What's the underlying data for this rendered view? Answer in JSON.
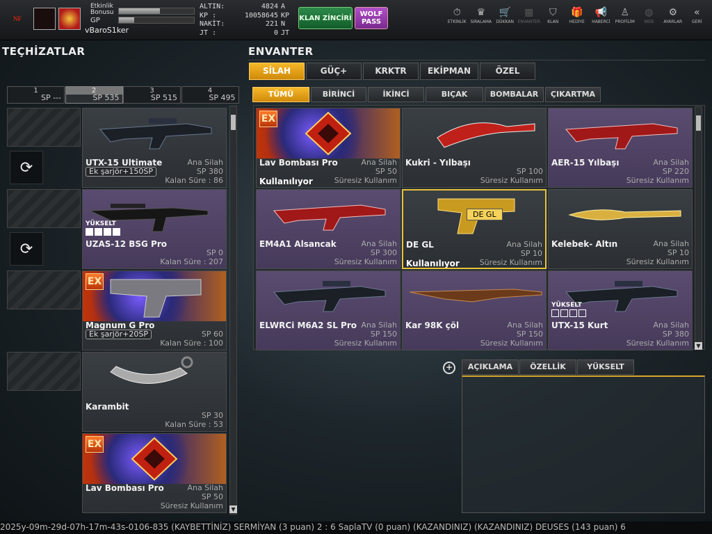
{
  "profile": {
    "bonus_label": "Etkinlik Bonusu",
    "gp_label": "GP",
    "username": "vBaroS1ker",
    "bonus_fill": 0.55,
    "gp_fill": 0.2
  },
  "currency": [
    {
      "label": "ALTIN:",
      "value": "4824",
      "unit": "A"
    },
    {
      "label": "KP   :",
      "value": "10058645",
      "unit": "KP"
    },
    {
      "label": "NAKİT:",
      "value": "221",
      "unit": "N"
    },
    {
      "label": "JT   :",
      "value": "0",
      "unit": "JT"
    }
  ],
  "buttons": {
    "clan": "KLAN ZİNCİRİ",
    "wolf": "WOLF PASS"
  },
  "nav": [
    {
      "label": "ETKİNLİK",
      "icon": "⏱",
      "dim": false
    },
    {
      "label": "SIRALAMA",
      "icon": "♛",
      "dim": false
    },
    {
      "label": "DÜKKAN",
      "icon": "🛒",
      "dim": false
    },
    {
      "label": "ENVANTER",
      "icon": "▦",
      "dim": true
    },
    {
      "label": "KLAN",
      "icon": "⛉",
      "dim": false
    },
    {
      "label": "HEDİYE",
      "icon": "🎁",
      "dim": false
    },
    {
      "label": "HABERCİ",
      "icon": "📢",
      "dim": false
    },
    {
      "label": "PROFİLİM",
      "icon": "♙",
      "dim": false
    },
    {
      "label": "WEB",
      "icon": "◍",
      "dim": true
    },
    {
      "label": "AYARLAR",
      "icon": "⚙",
      "dim": false
    },
    {
      "label": "GERİ",
      "icon": "«",
      "dim": false
    }
  ],
  "titles": {
    "equip": "TEÇHİZATLAR",
    "inventory": "ENVANTER"
  },
  "sp_tabs": [
    {
      "num": "1",
      "sp": "SP ---"
    },
    {
      "num": "2",
      "sp": "SP 535"
    },
    {
      "num": "3",
      "sp": "SP 515"
    },
    {
      "num": "4",
      "sp": "SP 495"
    }
  ],
  "equipment": [
    {
      "name": "UTX-15 Ultimate",
      "cat": "Ana Silah",
      "sp": "SP 380",
      "dur": "Kalan Süre : 86",
      "opt": "Ek şarjör+150SP"
    },
    {
      "name": "UZAS-12 BSG Pro",
      "sp": "SP 0",
      "dur": "Kalan Süre : 207",
      "yuksel": "YÜKSELT"
    },
    {
      "name": "Magnum G Pro",
      "sp": "SP 60",
      "dur": "Kalan Süre : 100",
      "opt": "Ek şarjör+20SP",
      "ex": "EX"
    },
    {
      "name": "Karambit",
      "sp": "SP 30",
      "dur": "Kalan Süre : 53"
    },
    {
      "name": "Lav Bombası Pro",
      "cat": "Ana Silah",
      "sp": "SP 50",
      "dur": "Süresiz Kullanım",
      "ex": "EX"
    }
  ],
  "main_tabs": [
    "SİLAH",
    "GÜÇ+",
    "KRKTR",
    "EKİPMAN",
    "ÖZEL"
  ],
  "sub_tabs": [
    "TÜMÜ",
    "BİRİNCİ",
    "İKİNCİ",
    "BIÇAK",
    "BOMBALAR",
    "ÇIKARTMA"
  ],
  "inventory": [
    {
      "name": "Lav Bombası Pro",
      "cat": "Ana Silah",
      "sp": "SP 50",
      "dur": "Süresiz Kullanım",
      "using": "Kullanılıyor",
      "ex": "EX"
    },
    {
      "name": "Kukri - Yılbaşı",
      "sp": "SP 100",
      "dur": "Süresiz Kullanım"
    },
    {
      "name": "AER-15 Yılbaşı",
      "cat": "Ana Silah",
      "sp": "SP 220",
      "dur": "Süresiz Kullanım"
    },
    {
      "name": "EM4A1 Alsancak",
      "cat": "Ana Silah",
      "sp": "SP 300",
      "dur": "Süresiz Kullanım"
    },
    {
      "name": "DE GL",
      "cat": "Ana Silah",
      "sp": "SP 10",
      "dur": "Süresiz Kullanım",
      "using": "Kullanılıyor"
    },
    {
      "name": "Kelebek- Altın",
      "cat": "Ana Silah",
      "sp": "SP 10",
      "dur": "Süresiz Kullanım"
    },
    {
      "name": "ELWRCi M6A2 SL Pro",
      "cat": "Ana Silah",
      "sp": "SP 150",
      "dur": "Süresiz Kullanım"
    },
    {
      "name": "Kar 98K çöl",
      "cat": "Ana Silah",
      "sp": "SP 150",
      "dur": "Süresiz Kullanım"
    },
    {
      "name": "UTX-15 Kurt",
      "cat": "Ana Silah",
      "sp": "SP 380",
      "dur": "Süresiz Kullanım",
      "yuksel": "YÜKSELT"
    }
  ],
  "tooltip": "DE GL",
  "desc_tabs": [
    "AÇIKLAMA",
    "ÖZELLİK",
    "YÜKSELT"
  ],
  "ticker": "2025y-09m-29d-07h-17m-43s-0106-835   (KAYBETTİNİZ) SERMİYAN (3 puan) 2 : 6 SaplaTV (0 puan) (KAZANDINIZ)          (KAZANDINIZ) DEUSES (143 puan) 6",
  "colors": {
    "accent": "#f5b82a",
    "selected_border": "#e8c23a",
    "card_purple": "#5a4c70"
  }
}
